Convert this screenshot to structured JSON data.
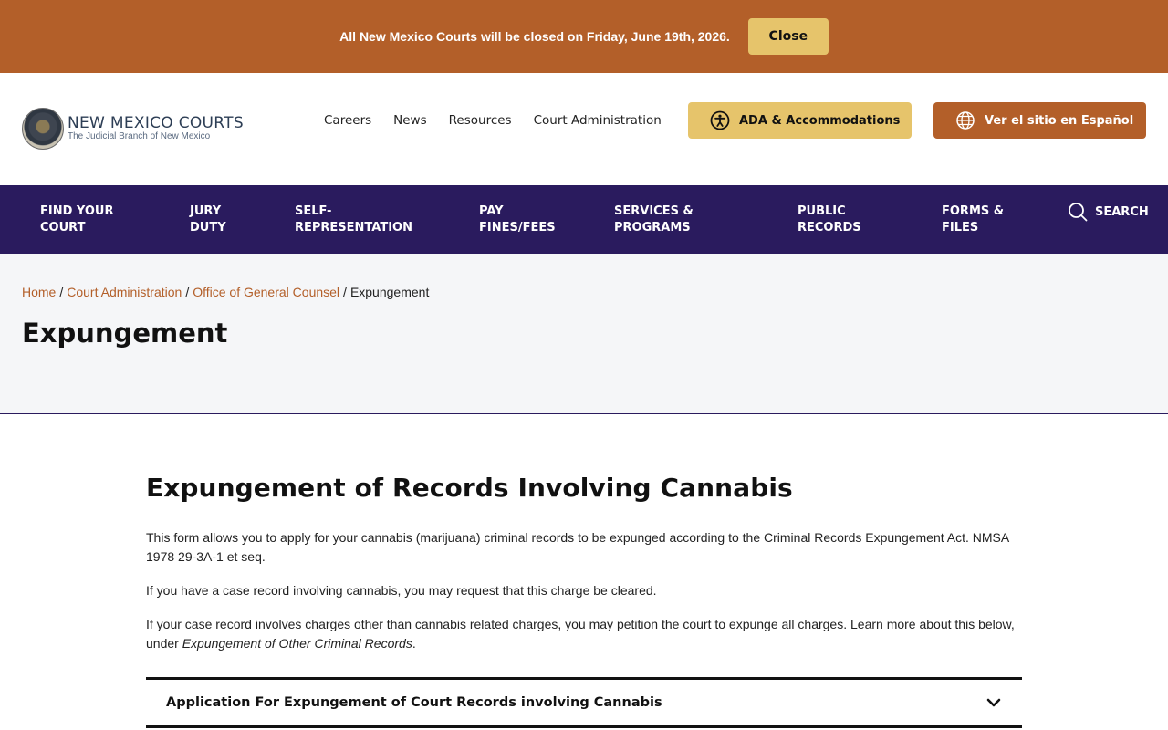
{
  "alert": {
    "message": "All New Mexico Courts will be closed on Friday, June 19th, 2026.",
    "close_label": "Close"
  },
  "header": {
    "logo_title": "NEW MEXICO COURTS",
    "logo_subtitle": "The Judicial Branch of New Mexico",
    "links": [
      "Careers",
      "News",
      "Resources",
      "Court Administration"
    ],
    "ada_label": "ADA & Accommodations",
    "spanish_label": "Ver el sitio en Español"
  },
  "nav": {
    "items": [
      "FIND YOUR\nCOURT",
      "JURY\nDUTY",
      "SELF-\nREPRESENTATION",
      "PAY\nFINES/FEES",
      "SERVICES &\nPROGRAMS",
      "PUBLIC\nRECORDS",
      "FORMS &\nFILES"
    ],
    "search_label": "SEARCH"
  },
  "breadcrumb": {
    "home": "Home",
    "court_admin": "Court Administration",
    "counsel": "Office of General Counsel",
    "current": "Expungement"
  },
  "page": {
    "title": "Expungement"
  },
  "content": {
    "heading": "Expungement of Records Involving Cannabis",
    "p1": "This form allows you to apply for your cannabis (marijuana) criminal records to be expunged according to the Criminal Records Expungement Act. NMSA 1978 29-3A-1 et seq.",
    "p2": "If you have a case record involving cannabis, you may request that this charge be cleared.",
    "p3_start": "If your case record involves charges other than cannabis related charges, you may petition the court to expunge all charges. Learn more about this below, under ",
    "p3_em": "Expungement of Other Criminal Records",
    "p3_end": ".",
    "accordion_label": "Application For Expungement of Court Records involving Cannabis"
  },
  "colors": {
    "brand_orange": "#b35f29",
    "brand_gold": "#e6c46b",
    "nav_purple": "#2a1b5e"
  }
}
